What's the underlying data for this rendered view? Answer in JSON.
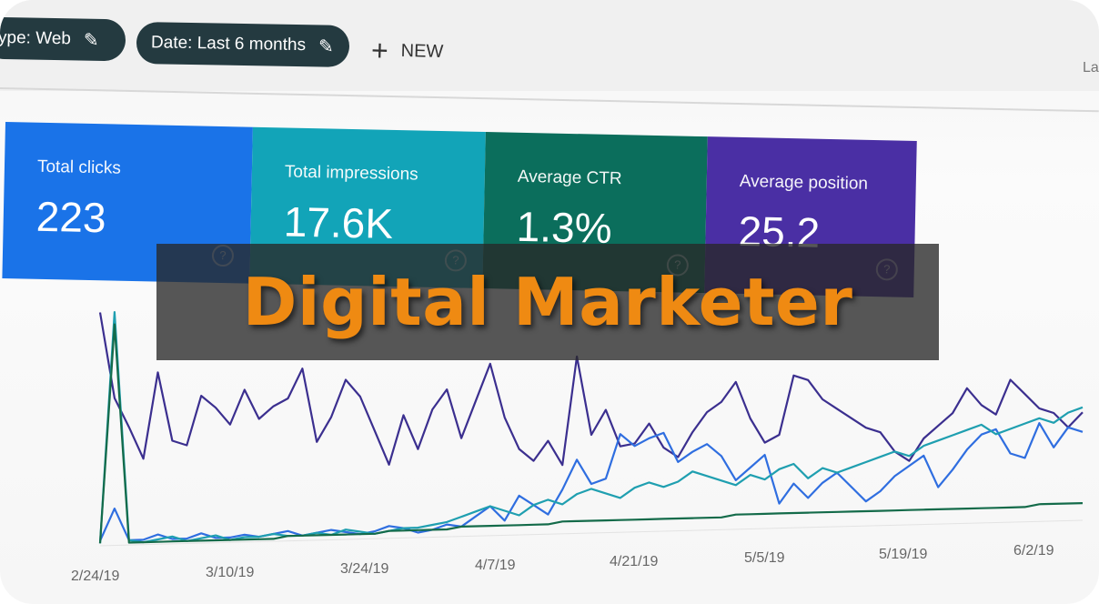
{
  "filters": {
    "type_chip": "ype: Web",
    "date_chip": "Date: Last 6 months",
    "new_button": "NEW",
    "corner_text": "La"
  },
  "metric_cards": [
    {
      "label": "Total clicks",
      "value": "223",
      "color": "#1a73e8"
    },
    {
      "label": "Total impressions",
      "value": "17.6K",
      "color": "#12a4b8"
    },
    {
      "label": "Average CTR",
      "value": "1.3%",
      "color": "#0b6e5c"
    },
    {
      "label": "Average position",
      "value": "25.2",
      "color": "#4a2fa4"
    }
  ],
  "banner": {
    "title": "Digital Marketer",
    "title_color": "#ef8a12"
  },
  "icons": {
    "edit": "pencil-icon",
    "add": "plus-icon",
    "help": "help-circle-icon"
  },
  "chart_data": {
    "type": "line",
    "x_labels": [
      "2/24/19",
      "3/10/19",
      "3/24/19",
      "4/7/19",
      "4/21/19",
      "5/5/19",
      "5/19/19",
      "6/2/19"
    ],
    "series": [
      {
        "color": "#3b2f8f",
        "values": [
          95,
          60,
          48,
          35,
          70,
          42,
          40,
          60,
          55,
          48,
          62,
          50,
          55,
          58,
          70,
          40,
          50,
          65,
          58,
          44,
          30,
          50,
          36,
          52,
          60,
          40,
          55,
          70,
          48,
          35,
          30,
          38,
          28,
          72,
          40,
          50,
          35,
          36,
          44,
          34,
          30,
          40,
          48,
          52,
          60,
          45,
          35,
          38,
          62,
          60,
          52,
          48,
          44,
          40,
          38,
          30,
          26,
          35,
          40,
          45,
          55,
          48,
          44,
          58,
          52,
          46,
          44,
          38,
          44
        ]
      },
      {
        "color": "#2f6ee0",
        "values": [
          2,
          15,
          2,
          2,
          4,
          2,
          2,
          4,
          2,
          2,
          3,
          2,
          3,
          4,
          2,
          3,
          4,
          3,
          2,
          3,
          5,
          4,
          2,
          3,
          5,
          4,
          8,
          12,
          6,
          16,
          12,
          8,
          18,
          30,
          20,
          22,
          40,
          35,
          38,
          40,
          28,
          32,
          35,
          30,
          20,
          25,
          30,
          10,
          18,
          12,
          18,
          22,
          16,
          10,
          14,
          20,
          24,
          28,
          15,
          22,
          30,
          36,
          38,
          28,
          26,
          40,
          30,
          38,
          36
        ]
      },
      {
        "color": "#1f9fb0",
        "values": [
          1,
          95,
          2,
          1,
          2,
          3,
          1,
          2,
          3,
          1,
          2,
          2,
          3,
          2,
          2,
          3,
          2,
          4,
          3,
          2,
          3,
          4,
          4,
          5,
          6,
          8,
          10,
          12,
          10,
          8,
          12,
          14,
          12,
          16,
          18,
          16,
          14,
          18,
          20,
          18,
          20,
          24,
          22,
          20,
          18,
          22,
          20,
          24,
          26,
          20,
          24,
          22,
          24,
          26,
          28,
          30,
          28,
          32,
          34,
          36,
          38,
          40,
          36,
          38,
          40,
          42,
          40,
          44,
          46
        ]
      },
      {
        "color": "#146b4a",
        "values": [
          1,
          90,
          1,
          1,
          1,
          1,
          1,
          1,
          1,
          1,
          1,
          1,
          1,
          2,
          2,
          2,
          2,
          2,
          2,
          2,
          3,
          3,
          3,
          3,
          3,
          4,
          4,
          4,
          4,
          4,
          4,
          4,
          5,
          5,
          5,
          5,
          5,
          5,
          5,
          5,
          5,
          5,
          5,
          5,
          6,
          6,
          6,
          6,
          6,
          6,
          6,
          6,
          6,
          6,
          6,
          6,
          6,
          6,
          6,
          6,
          6,
          6,
          6,
          6,
          6,
          7,
          7,
          7,
          7
        ]
      }
    ]
  }
}
